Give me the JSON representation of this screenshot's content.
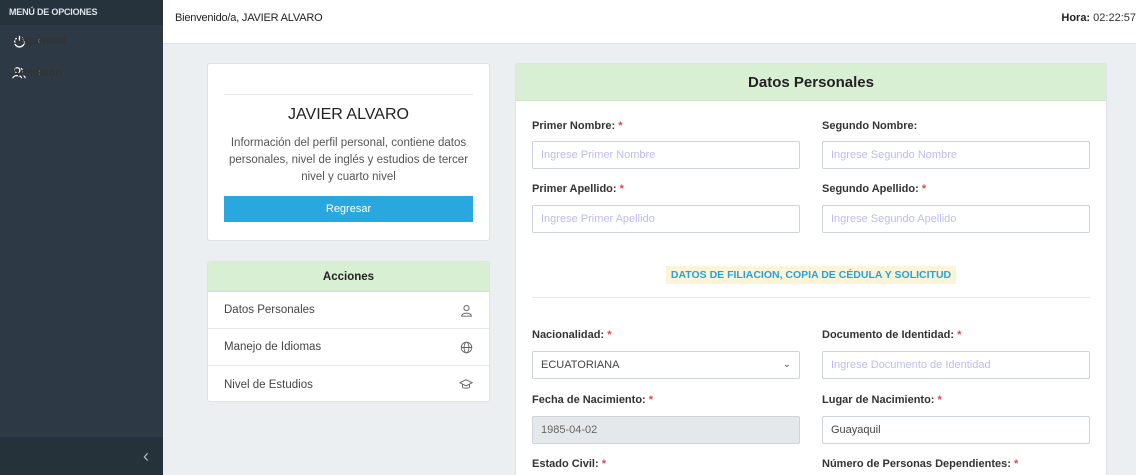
{
  "sidebar": {
    "header": "MENÚ DE OPCIONES",
    "items": [
      {
        "label": "Seguridad",
        "icon": "power-icon"
      },
      {
        "label": "Admision",
        "icon": "users-icon"
      }
    ],
    "collapse_glyph": "‹"
  },
  "topbar": {
    "welcome": "Bienvenido/a, JAVIER ALVARO",
    "hora_label": "Hora:",
    "hora_value": "02:22:57"
  },
  "profile": {
    "name": "JAVIER ALVARO",
    "description": "Información del perfil personal, contiene datos personales, nivel de inglés y estudios de tercer nivel y cuarto nivel",
    "back_button": "Regresar"
  },
  "acciones": {
    "title": "Acciones",
    "items": [
      {
        "label": "Datos Personales",
        "icon": "user-icon"
      },
      {
        "label": "Manejo de Idiomas",
        "icon": "globe-icon"
      },
      {
        "label": "Nivel de Estudios",
        "icon": "graduation-cap-icon"
      }
    ]
  },
  "form": {
    "title": "Datos Personales",
    "section_title": "DATOS DE FILIACION, COPIA DE CÉDULA Y SOLICITUD",
    "required_mark": "*",
    "primer_nombre": {
      "label": "Primer Nombre:",
      "placeholder": "Ingrese Primer Nombre"
    },
    "segundo_nombre": {
      "label": "Segundo Nombre:",
      "placeholder": "Ingrese Segundo Nombre"
    },
    "primer_apellido": {
      "label": "Primer Apellido:",
      "placeholder": "Ingrese Primer Apellido"
    },
    "segundo_apellido": {
      "label": "Segundo Apellido:",
      "placeholder": "Ingrese Segundo Apellido"
    },
    "nacionalidad": {
      "label": "Nacionalidad:",
      "value": "ECUATORIANA"
    },
    "documento": {
      "label": "Documento de Identidad:",
      "placeholder": "Ingrese Documento de Identidad"
    },
    "fecha_nacimiento": {
      "label": "Fecha de Nacimiento:",
      "value": "1985-04-02"
    },
    "lugar_nacimiento": {
      "label": "Lugar de Nacimiento:",
      "value": "Guayaquil"
    },
    "estado_civil": {
      "label": "Estado Civil:"
    },
    "dependientes": {
      "label": "Número de Personas Dependientes:"
    }
  },
  "colors": {
    "sidebar_bg": "#2d3a45",
    "header_green": "#d9efd3",
    "button_blue": "#29a8e0",
    "required_red": "#e24646",
    "section_blue": "#2aa1d8"
  }
}
